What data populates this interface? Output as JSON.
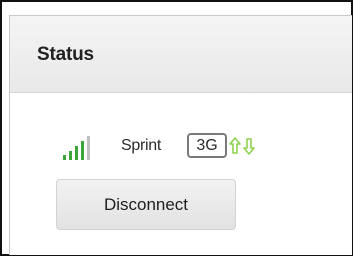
{
  "status_panel": {
    "title": "Status",
    "connection": {
      "signal_icon": "signal-bars-icon",
      "signal_bars": 4,
      "signal_color": "#3aa63a",
      "carrier": "Sprint",
      "network_type": "3G",
      "traffic_icon": "up-down-arrows-icon",
      "traffic_color": "#8fd14f"
    },
    "disconnect_label": "Disconnect"
  }
}
